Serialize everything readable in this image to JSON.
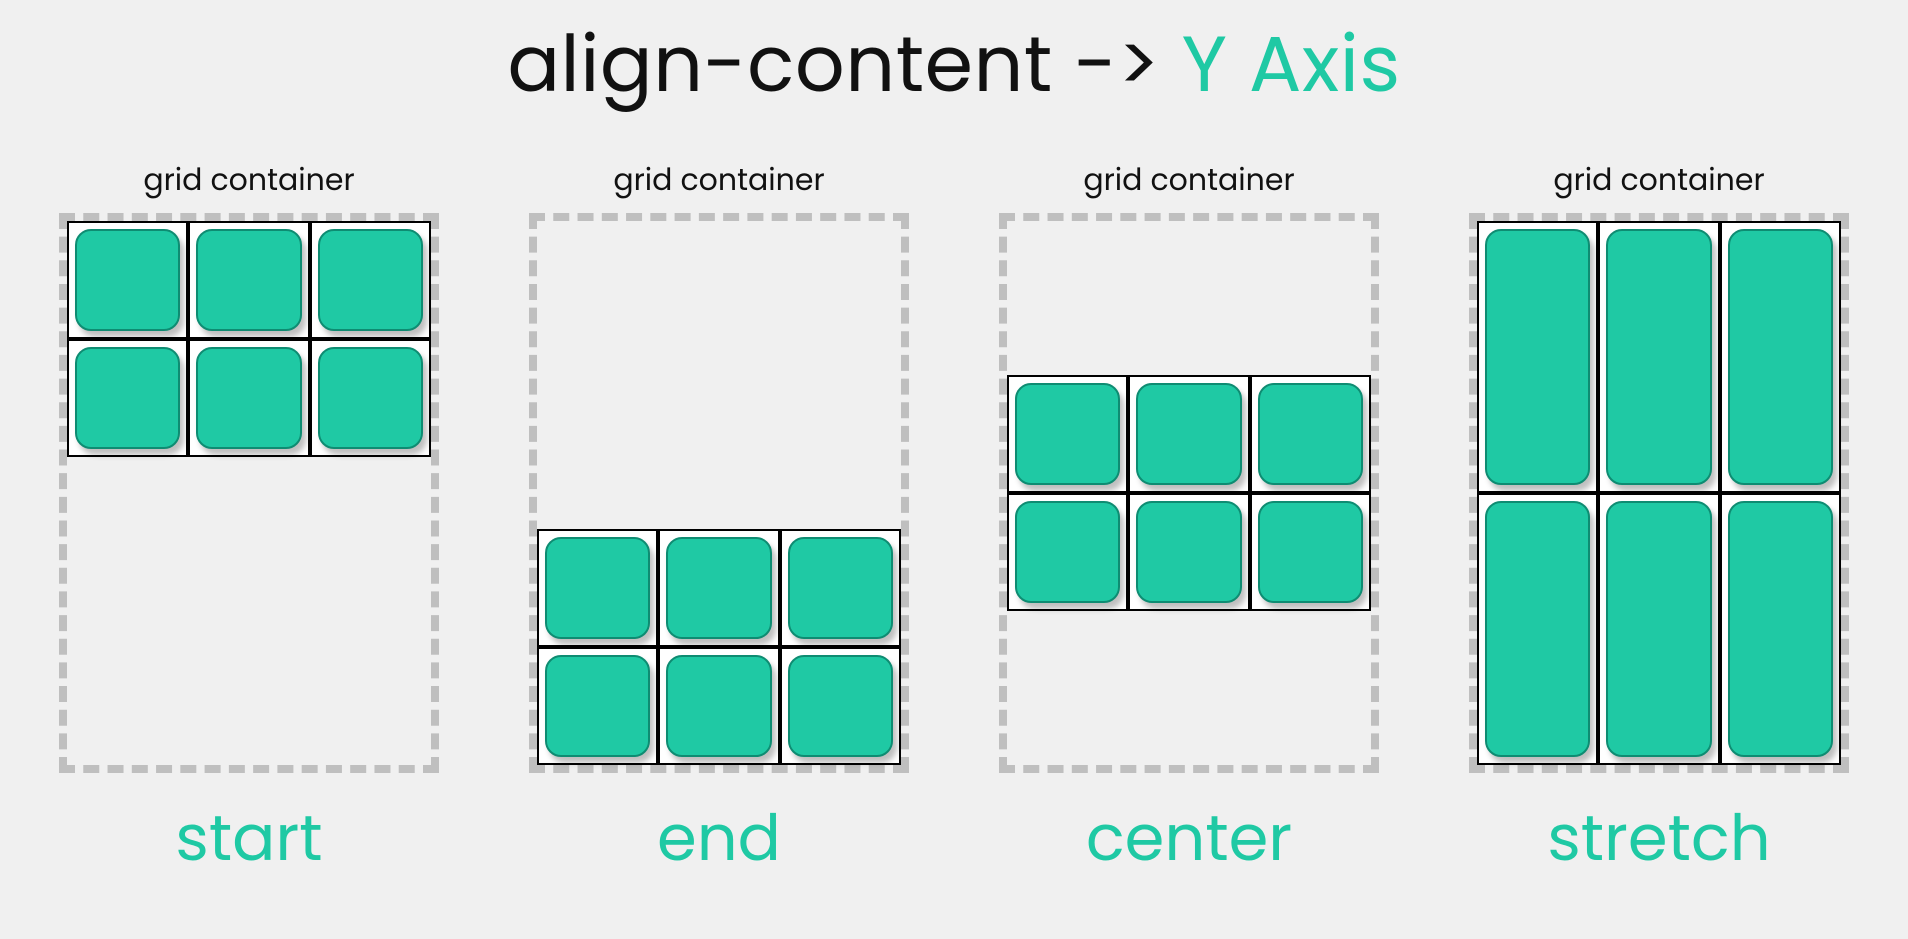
{
  "title": {
    "property": "align-content ->",
    "axis": "Y Axis"
  },
  "container_label": "grid container",
  "items_per_grid": 6,
  "panels": [
    {
      "value": "start",
      "mode": "start"
    },
    {
      "value": "end",
      "mode": "end"
    },
    {
      "value": "center",
      "mode": "center"
    },
    {
      "value": "stretch",
      "mode": "stretch"
    }
  ],
  "colors": {
    "accent": "#1fc9a4",
    "ink": "#111111",
    "bg": "#f0f0f0",
    "dash": "#bfbfbf"
  }
}
